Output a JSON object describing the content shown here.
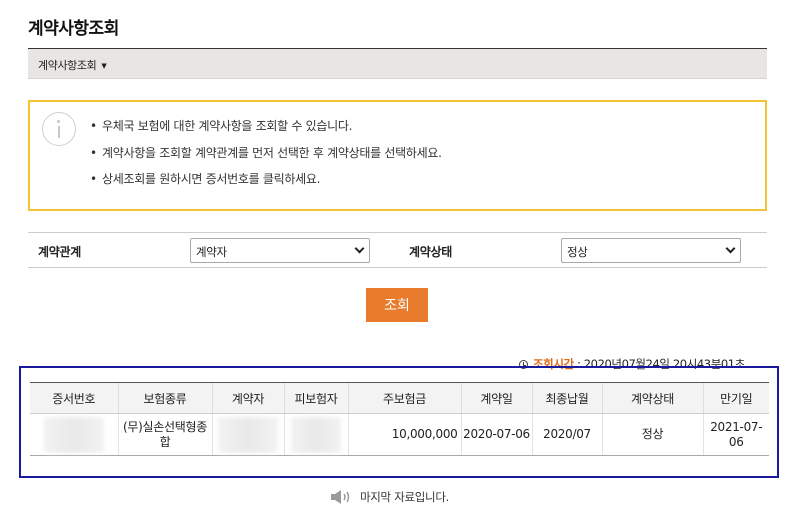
{
  "page": {
    "title": "계약사항조회"
  },
  "breadcrumb": {
    "label": "계약사항조회",
    "caret": "▼"
  },
  "notice": {
    "items": [
      "우체국 보험에 대한 계약사항을 조회할 수 있습니다.",
      "계약사항을 조회할 계약관계를 먼저 선택한 후 계약상태를 선택하세요.",
      "상세조회를 원하시면 증서번호를 클릭하세요."
    ]
  },
  "filters": {
    "relation_label": "계약관계",
    "relation_value": "계약자",
    "status_label": "계약상태",
    "status_value": "정상"
  },
  "search": {
    "button_label": "조회"
  },
  "query_time": {
    "label": "조회시간",
    "separator": " : ",
    "value": "2020년07월24일 20시43분01초"
  },
  "table": {
    "headers": [
      "증서번호",
      "보험종류",
      "계약자",
      "피보험자",
      "주보험금",
      "계약일",
      "최종납월",
      "계약상태",
      "만기일"
    ],
    "rows": [
      {
        "cert_no": "",
        "insurance_type_line1": "(무)실손선택형종",
        "insurance_type_line2": "합",
        "contractor": "",
        "insured": "",
        "main_amount": "10,000,000",
        "contract_date": "2020-07-06",
        "last_paid_month": "2020/07",
        "status": "정상",
        "maturity_date": "2021-07-06"
      }
    ]
  },
  "footer": {
    "end_message": "마지막 자료입니다."
  },
  "colors": {
    "accent_orange": "#e87b2c",
    "notice_border": "#f1c232",
    "highlight_frame": "#1a1a9c",
    "query_label": "#e06b1a"
  },
  "icons": {
    "notice": "info-circle-icon",
    "select": "chevron-down-icon",
    "time": "clock-icon",
    "footer": "speaker-icon",
    "breadcrumb": "caret-down-icon"
  }
}
